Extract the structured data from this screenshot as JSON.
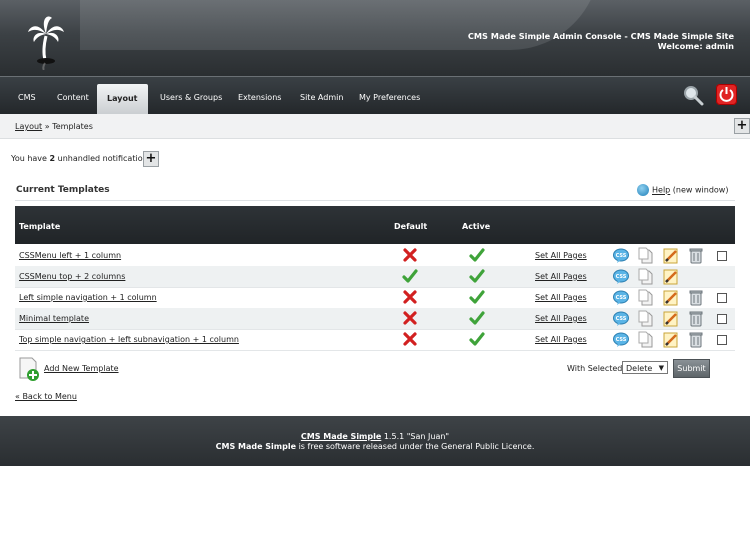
{
  "header": {
    "console_title": "CMS Made Simple Admin Console - CMS Made Simple Site",
    "welcome": "Welcome: admin"
  },
  "nav": {
    "items": [
      {
        "label": "CMS"
      },
      {
        "label": "Content"
      },
      {
        "label": "Layout",
        "active": true
      },
      {
        "label": "Users & Groups"
      },
      {
        "label": "Extensions"
      },
      {
        "label": "Site Admin"
      },
      {
        "label": "My Preferences"
      }
    ],
    "icons": [
      "search-icon",
      "logout-icon"
    ]
  },
  "breadcrumb": {
    "link": "Layout",
    "separator": "»",
    "current": "Templates"
  },
  "notifications": {
    "prefix": "You have",
    "count": "2",
    "suffix": "unhandled notifications"
  },
  "section": {
    "title": "Current Templates",
    "help_link": "Help",
    "help_suffix": "(new window)"
  },
  "table": {
    "columns": {
      "template": "Template",
      "default": "Default",
      "active": "Active"
    },
    "set_all_label": "Set All Pages",
    "rows": [
      {
        "name": "CSSMenu left + 1 column",
        "default": false,
        "active": true,
        "deletable": true
      },
      {
        "name": "CSSMenu top + 2 columns",
        "default": true,
        "active": true,
        "deletable": false
      },
      {
        "name": "Left simple navigation + 1 column",
        "default": false,
        "active": true,
        "deletable": true
      },
      {
        "name": "Minimal template",
        "default": false,
        "active": true,
        "deletable": true
      },
      {
        "name": "Top simple navigation + left subnavigation + 1 column",
        "default": false,
        "active": true,
        "deletable": true
      }
    ]
  },
  "actions": {
    "add_new": "Add New Template",
    "with_selected": "With Selected:",
    "selected_option": "Delete",
    "submit": "Submit",
    "back": "« Back to Menu"
  },
  "footer": {
    "product_link": "CMS Made Simple",
    "version": "1.5.1 \"San Juan\"",
    "product_bold": "CMS Made Simple",
    "license": "is free software released under the General Public Licence."
  },
  "colors": {
    "nav_bg": "#2a2e31",
    "cross": "#d22020",
    "check": "#3fa33a",
    "logout": "#e02424"
  }
}
